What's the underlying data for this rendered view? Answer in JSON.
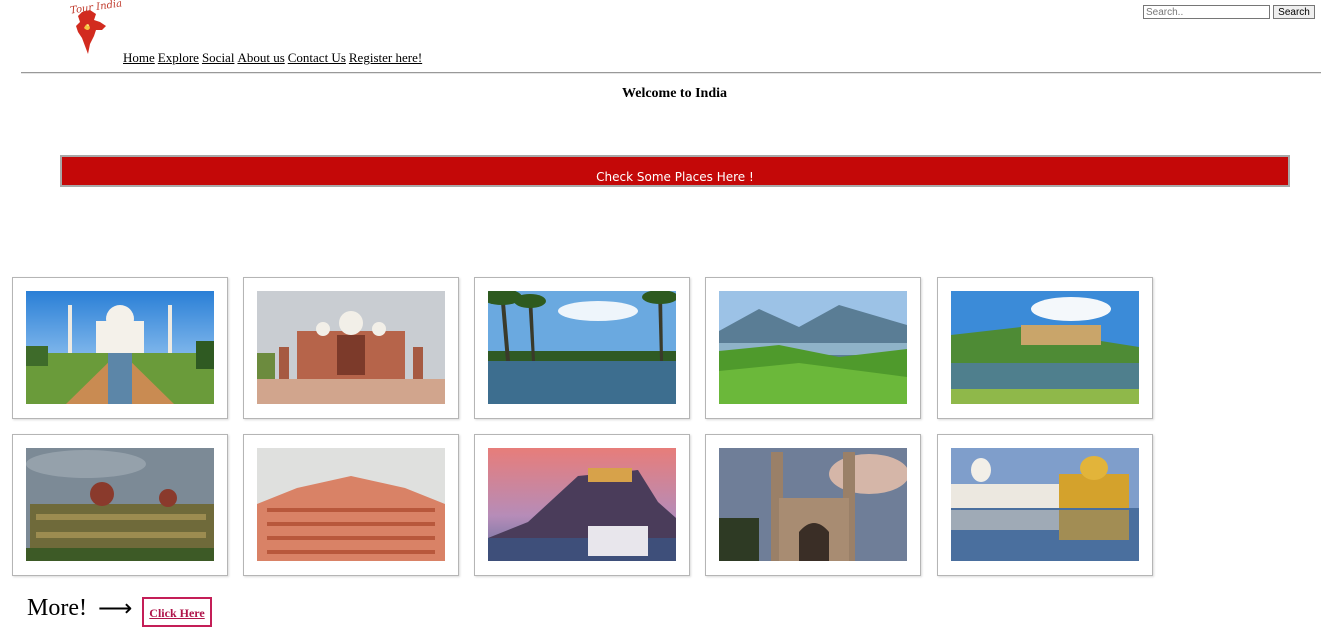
{
  "logo": {
    "text": "Tour India"
  },
  "nav": {
    "items": [
      "Home",
      "Explore",
      "Social",
      "About us",
      "Contact Us",
      "Register here!"
    ]
  },
  "search": {
    "placeholder": "Search..",
    "button_label": "Search"
  },
  "page": {
    "title": "Welcome to India",
    "banner": "Check Some Places Here !",
    "more_label": "More!",
    "arrow": "⟶",
    "click_here": "Click Here"
  },
  "gallery": [
    {
      "icon": "taj-mahal-photo"
    },
    {
      "icon": "red-mosque-photo"
    },
    {
      "icon": "kerala-backwaters-photo"
    },
    {
      "icon": "munnar-hills-photo"
    },
    {
      "icon": "amer-fort-photo"
    },
    {
      "icon": "taj-hotel-mumbai-photo"
    },
    {
      "icon": "hawa-mahal-photo"
    },
    {
      "icon": "mehrangarh-fort-photo"
    },
    {
      "icon": "charminar-photo"
    },
    {
      "icon": "golden-temple-photo"
    }
  ]
}
